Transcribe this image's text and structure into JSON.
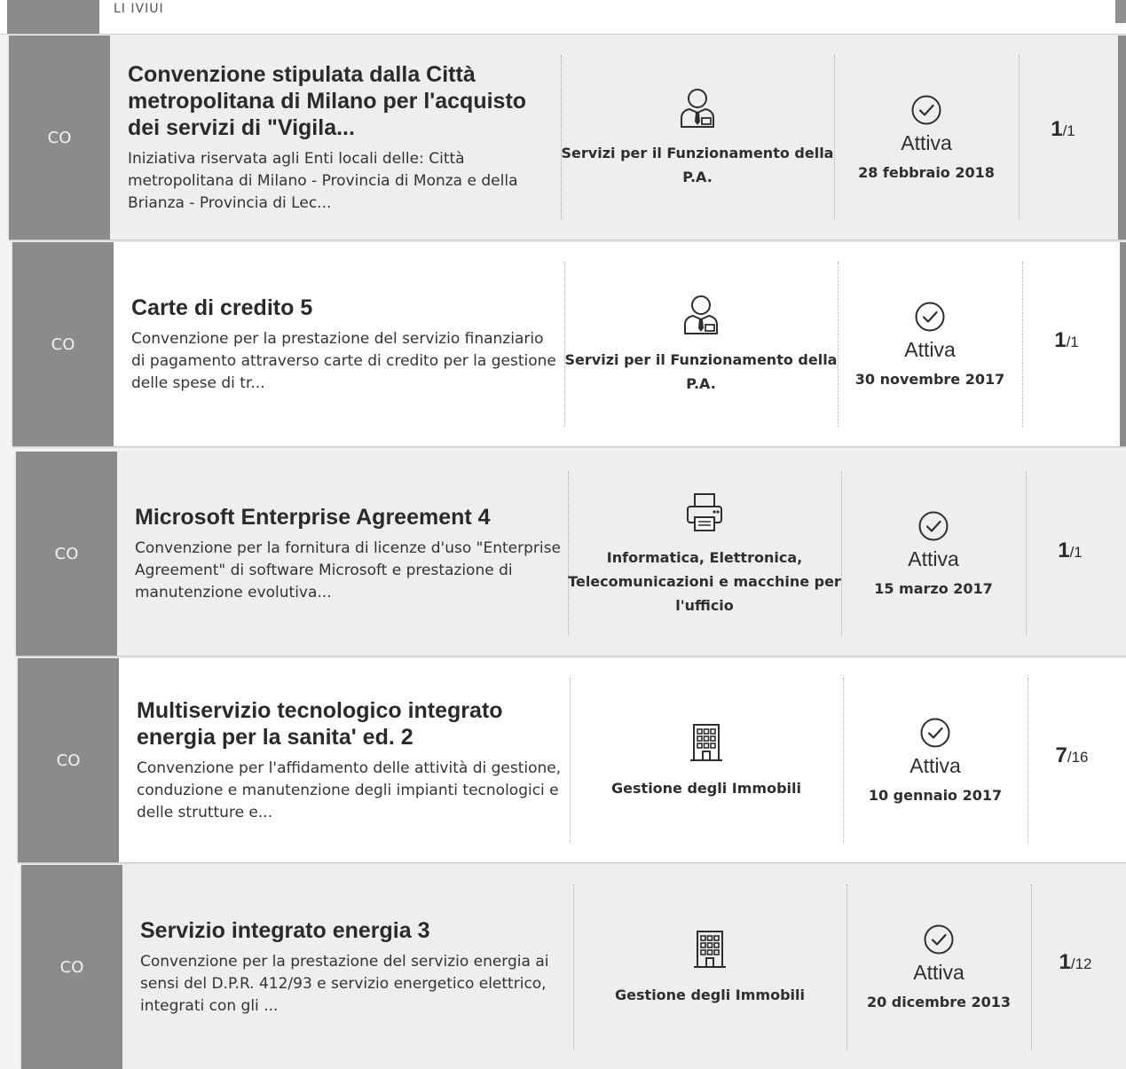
{
  "header_cut_text": "LI IVIUI",
  "rows": [
    {
      "badge": "CO",
      "title": "Convenzione stipulata dalla Città metropolitana di Milano per l'acquisto dei servizi di \"Vigila...",
      "description": "Iniziativa riservata agli Enti locali delle: Città metropolitana di Milano - Provincia di Monza e della Brianza - Provincia di Lec...",
      "category": "Servizi per il Funzionamento della P.A.",
      "category_icon": "person-tie-icon",
      "status": "Attiva",
      "date": "28 febbraio 2018",
      "count_num": "1",
      "count_den": "/1"
    },
    {
      "badge": "CO",
      "title": "Carte di credito 5",
      "description": "Convenzione per la prestazione del servizio finanziario di pagamento attraverso carte di credito per la gestione delle spese di tr...",
      "category": "Servizi per il Funzionamento della P.A.",
      "category_icon": "person-tie-icon",
      "status": "Attiva",
      "date": "30 novembre 2017",
      "count_num": "1",
      "count_den": "/1"
    },
    {
      "badge": "CO",
      "title": "Microsoft Enterprise Agreement 4",
      "description": "Convenzione per la fornitura di licenze d'uso \"Enterprise Agreement\" di software Microsoft e prestazione di manutenzione evolutiva...",
      "category": "Informatica, Elettronica, Telecomunicazioni e macchine per l'ufficio",
      "category_icon": "printer-icon",
      "status": "Attiva",
      "date": "15 marzo 2017",
      "count_num": "1",
      "count_den": "/1"
    },
    {
      "badge": "CO",
      "title": "Multiservizio tecnologico integrato energia per la sanita' ed. 2",
      "description": "Convenzione per l'affidamento delle attività di gestione, conduzione e manutenzione degli impianti tecnologici e delle strutture e...",
      "category": "Gestione degli Immobili",
      "category_icon": "building-icon",
      "status": "Attiva",
      "date": "10 gennaio 2017",
      "count_num": "7",
      "count_den": "/16"
    },
    {
      "badge": "CO",
      "title": "Servizio integrato energia 3",
      "description": "Convenzione per la prestazione del servizio energia ai sensi del D.P.R. 412/93 e servizio energetico elettrico, integrati con gli ...",
      "category": "Gestione degli Immobili",
      "category_icon": "building-icon",
      "status": "Attiva",
      "date": "20 dicembre 2013",
      "count_num": "1",
      "count_den": "/12"
    }
  ]
}
